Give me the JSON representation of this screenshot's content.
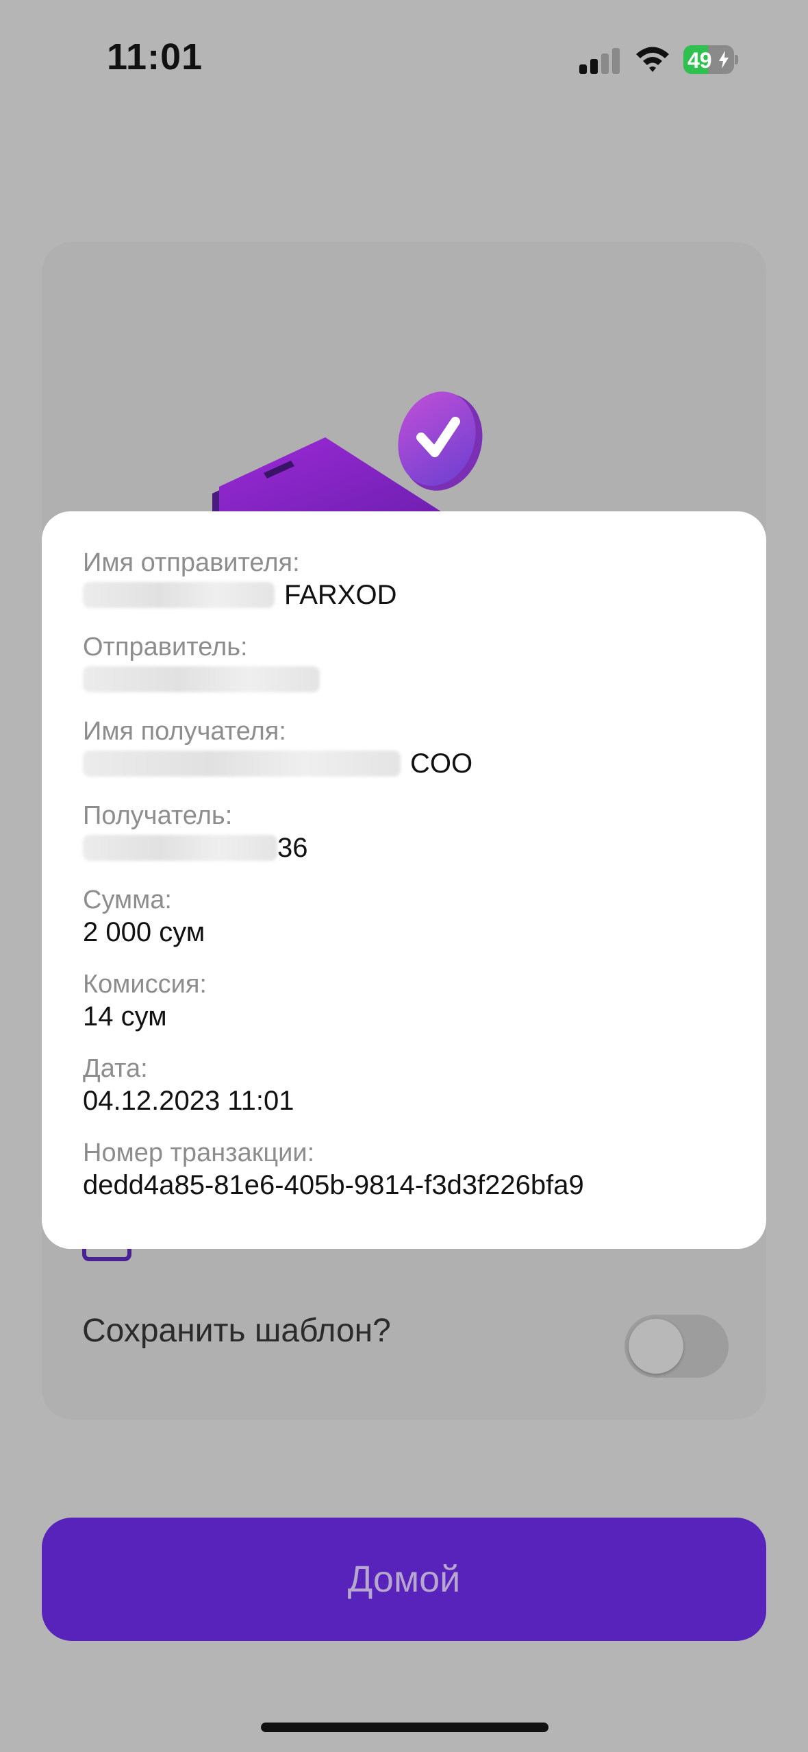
{
  "status_bar": {
    "time": "11:01",
    "battery_level": "49",
    "battery_charging": true,
    "signal_bars_active": 2,
    "icons": [
      "cellular-signal-icon",
      "wifi-icon",
      "battery-charging-icon"
    ],
    "battery_color": "#2fc04f"
  },
  "background": {
    "save_template_label": "Сохранить шаблон?",
    "save_template_on": false,
    "illustration": [
      "phone-illustration-icon",
      "check-coin-icon"
    ]
  },
  "receipt": {
    "fields": [
      {
        "label": "Имя отправителя:",
        "value": "FARXOD",
        "masked_prefix": true
      },
      {
        "label": "Отправитель:",
        "value": "",
        "masked_prefix": true
      },
      {
        "label": "Имя получателя:",
        "value": "COO",
        "masked_prefix": true
      },
      {
        "label": "Получатель:",
        "value": "36",
        "masked_prefix": true
      },
      {
        "label": "Сумма:",
        "value": "2 000 сум"
      },
      {
        "label": "Комиссия:",
        "value": "14 сум"
      },
      {
        "label": "Дата:",
        "value": "04.12.2023 11:01"
      },
      {
        "label": "Номер транзакции:",
        "value": "dedd4a85-81e6-405b-9814-f3d3f226bfa9"
      }
    ]
  },
  "actions": {
    "home_label": "Домой"
  },
  "colors": {
    "accent": "#5723ba",
    "backdrop": "#b5b5b5",
    "modal": "#ffffff"
  }
}
